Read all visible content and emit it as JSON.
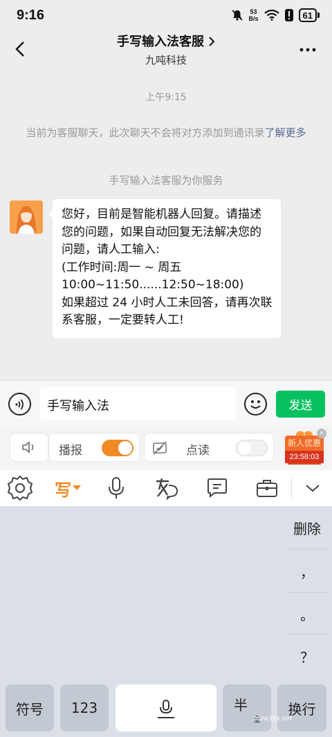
{
  "status_bar": {
    "time": "9:16",
    "net_speed_value": "53",
    "net_speed_unit": "B/s",
    "battery": "61"
  },
  "nav": {
    "title": "手写输入法客服",
    "subtitle": "九吨科技",
    "icons": [
      "back-arrow-icon",
      "chevron-right-icon",
      "more-icon"
    ]
  },
  "chat": {
    "timestamp": "上午9:15",
    "notice_text": "当前为客服聊天，此次聊天不会将对方添加到通讯录",
    "notice_link": "了解更多",
    "service_notice": "手写输入法客服为你服务",
    "message": "您好，目前是智能机器人回复。请描述您的问题，如果自动回复无法解决您的问题，请人工输入:\n(工作时间:周一 ~ 周五 10:00~11:50......12:50~18:00)\n如果超过 24 小时人工未回答，请再次联系客服，一定要转人工!"
  },
  "input": {
    "value": "手写输入法",
    "send_label": "发送"
  },
  "keyboard": {
    "broadcast_label": "播报",
    "broadcast_on": true,
    "read_label": "点读",
    "read_on": false,
    "promo_title": "新人优惠",
    "promo_timer": "23:58:03",
    "promo_close": "×",
    "handwrite_label": "写",
    "side_keys": [
      "删除",
      "，",
      "。",
      "？"
    ],
    "bottom_keys": {
      "symbol": "符号",
      "numbers": "123",
      "half": "半",
      "full": "全",
      "enter": "换行"
    },
    "accent_color": "#f08a24"
  },
  "watermark": "www.kkx.net",
  "colors": {
    "send": "#07c160",
    "link": "#576b95",
    "accent": "#f08a24"
  }
}
